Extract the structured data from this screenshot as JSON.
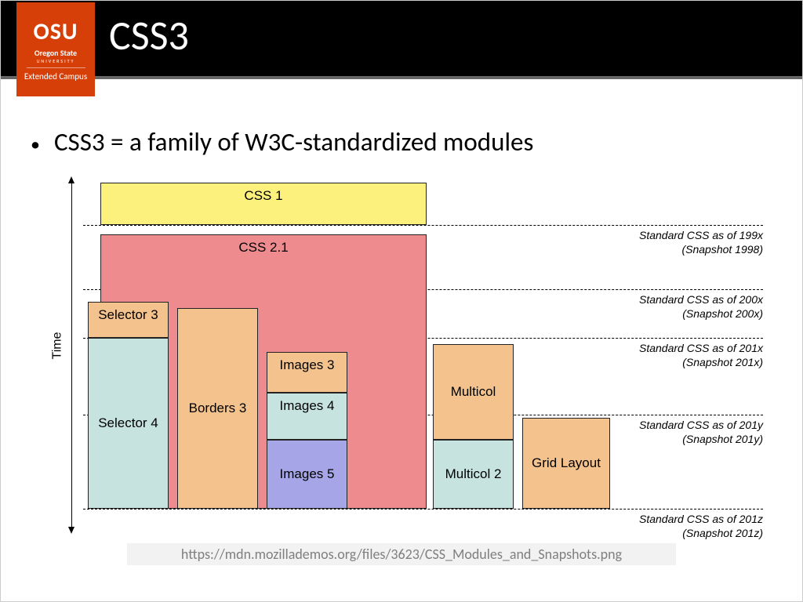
{
  "header": {
    "logo_main": "OSU",
    "logo_sub1": "Oregon State",
    "logo_sub2": "UNIVERSITY",
    "logo_sub3": "Extended Campus",
    "title": "CSS3"
  },
  "bullet": "CSS3 = a family of W3C-standardized modules",
  "axis": "Time",
  "snapshots": [
    {
      "line1": "Standard CSS as of 199x",
      "line2": "(Snapshot 1998)"
    },
    {
      "line1": "Standard CSS as of 200x",
      "line2": "(Snapshot 200x)"
    },
    {
      "line1": "Standard CSS as of 201x",
      "line2": "(Snapshot 201x)"
    },
    {
      "line1": "Standard CSS as of 201y",
      "line2": "(Snapshot 201y)"
    },
    {
      "line1": "Standard CSS as of 201z",
      "line2": "(Snapshot 201z)"
    }
  ],
  "blocks": {
    "css1": "CSS 1",
    "css21": "CSS 2.1",
    "sel3": "Selector 3",
    "sel4": "Selector 4",
    "borders3": "Borders 3",
    "images3": "Images 3",
    "images4": "Images 4",
    "images5": "Images 5",
    "multicol": "Multicol",
    "multicol2": "Multicol 2",
    "grid": "Grid Layout"
  },
  "footer": "https://mdn.mozillademos.org/files/3623/CSS_Modules_and_Snapshots.png",
  "chart_data": {
    "type": "timeline-blocks",
    "axis": "Time (increasing downward)",
    "snapshot_lines": [
      "199x (1998)",
      "200x",
      "201x",
      "201y",
      "201z"
    ],
    "columns": [
      {
        "name": "CSS 1",
        "color": "yellow",
        "span": [
          "top",
          "199x"
        ]
      },
      {
        "name": "CSS 2.1",
        "color": "pink",
        "span": [
          "199x",
          "201z"
        ]
      },
      {
        "name": "Selector 3",
        "color": "orange",
        "span": [
          "200x+",
          "201x"
        ]
      },
      {
        "name": "Selector 4",
        "color": "teal",
        "span": [
          "201x",
          "201z"
        ]
      },
      {
        "name": "Borders 3",
        "color": "orange",
        "span": [
          "200x+",
          "201z"
        ]
      },
      {
        "name": "Images 3",
        "color": "orange",
        "span": [
          "201x-",
          "201y-"
        ]
      },
      {
        "name": "Images 4",
        "color": "teal",
        "span": [
          "201y-",
          "201y+"
        ]
      },
      {
        "name": "Images 5",
        "color": "blue",
        "span": [
          "201y+",
          "201z"
        ]
      },
      {
        "name": "Multicol",
        "color": "orange",
        "span": [
          "201x",
          "201y+"
        ]
      },
      {
        "name": "Multicol 2",
        "color": "teal",
        "span": [
          "201y+",
          "201z"
        ]
      },
      {
        "name": "Grid Layout",
        "color": "orange",
        "span": [
          "201y",
          "201z"
        ]
      }
    ]
  }
}
